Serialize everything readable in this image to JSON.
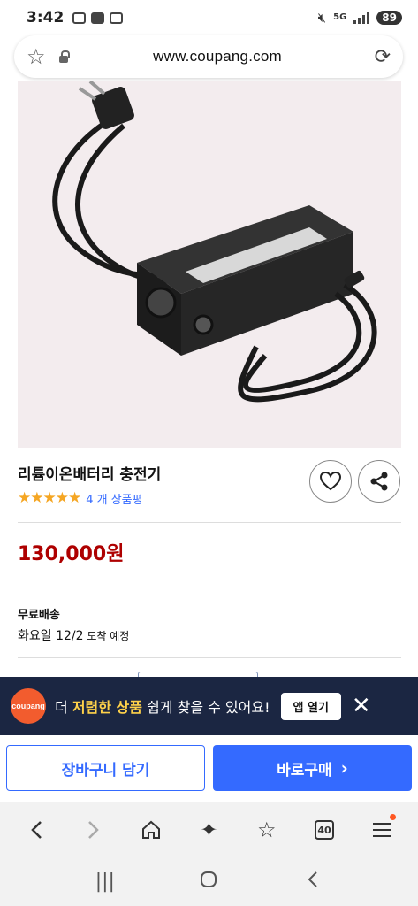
{
  "status_bar": {
    "time": "3:42",
    "network": "5G",
    "battery": "89"
  },
  "browser": {
    "url": "www.coupang.com"
  },
  "product": {
    "title": "리튬이온배터리 충전기",
    "stars": "★★★★★",
    "review_count": "4 개 상품평",
    "price": "130,000원",
    "image_label": "lithium-ion battery charger product photo"
  },
  "shipping": {
    "title": "무료배송",
    "date_main": "화요일 12/2",
    "date_suffix": " 도착 예정"
  },
  "app_banner": {
    "logo_text": "coupang",
    "text_pre": "더 ",
    "text_highlight": "저렴한 상품",
    "text_post": " 쉽게 찾을 수 있어요!",
    "open_button": "앱 열기",
    "close_icon": "✕"
  },
  "actions": {
    "cart_button": "장바구니 담기",
    "buy_button": "바로구매",
    "buy_arrow": "›"
  },
  "browser_nav": {
    "tab_count": "40"
  },
  "colors": {
    "accent_blue": "#346aff",
    "price_red": "#ae0000",
    "star_yellow": "#f5a623",
    "banner_bg": "#1b2642",
    "banner_highlight": "#ffd24a",
    "logo_orange": "#f25c2e"
  },
  "icons": {
    "url_left": "star-outline-icon",
    "lock": "lock-icon",
    "reload": "reload-icon",
    "wishlist": "heart-icon",
    "share": "share-icon",
    "nav": [
      "back-icon",
      "forward-icon",
      "home-icon",
      "sparkle-icon",
      "bookmark-star-icon",
      "tabs-icon",
      "menu-icon"
    ],
    "system": [
      "recents-icon",
      "home-circle-icon",
      "system-back-icon"
    ]
  }
}
